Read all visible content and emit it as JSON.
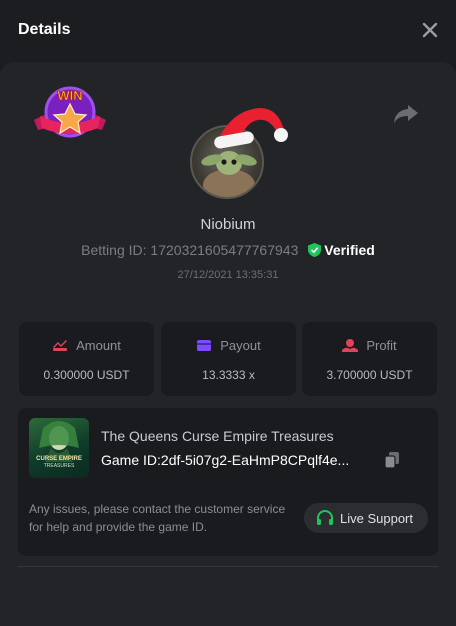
{
  "header": {
    "title": "Details"
  },
  "player": {
    "username": "Niobium",
    "betting_id_label": "Betting ID:",
    "betting_id": "1720321605477767943",
    "verified_label": "Verified",
    "timestamp": "27/12/2021 13:35:31",
    "badge_text": "WIN"
  },
  "stats": [
    {
      "label": "Amount",
      "value": "0.300000 USDT",
      "icon": "amount-icon",
      "color": "#e0435a"
    },
    {
      "label": "Payout",
      "value": "13.3333 x",
      "icon": "wallet-icon",
      "color": "#7b4dff"
    },
    {
      "label": "Profit",
      "value": "3.700000 USDT",
      "icon": "profit-icon",
      "color": "#e0435a"
    }
  ],
  "game": {
    "title": "The Queens Curse Empire Treasures",
    "id_label": "Game ID:",
    "id_value": "2df-5i07g2-EaHmP8CPqlf4e...",
    "thumb_line1": "CURSE EMPIRE",
    "thumb_line2": "TREASURES"
  },
  "support": {
    "help_text": "Any issues, please contact the customer service for help and provide the game ID.",
    "button_label": "Live Support"
  },
  "colors": {
    "accent_green": "#1fc55a",
    "panel": "#232428",
    "card": "#1a1b1e"
  }
}
